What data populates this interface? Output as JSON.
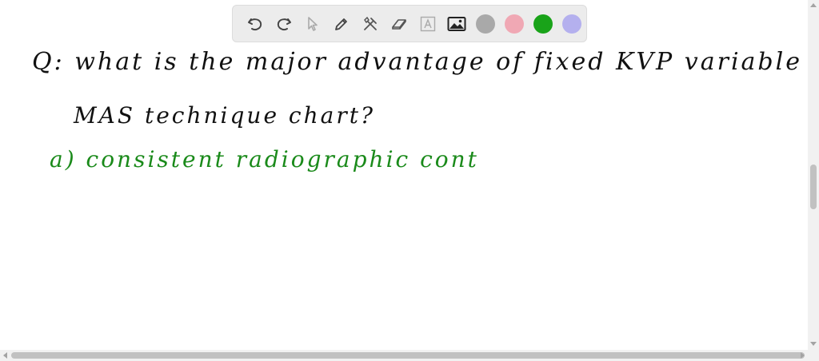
{
  "toolbar": {
    "tools": [
      {
        "icon": "undo-icon"
      },
      {
        "icon": "redo-icon"
      },
      {
        "icon": "select-pointer-icon"
      },
      {
        "icon": "pen-icon"
      },
      {
        "icon": "tools-icon"
      },
      {
        "icon": "eraser-icon"
      },
      {
        "icon": "text-icon"
      },
      {
        "icon": "image-icon"
      }
    ],
    "colors": [
      "#a9a9a9",
      "#f0a8b4",
      "#19a319",
      "#b4b0ee"
    ]
  },
  "notes": {
    "line1": "Q: what is the major advantage of fixed KVP variable",
    "line2": "MAS technique chart?",
    "line3": "a) consistent radiographic cont"
  },
  "ink_colors": {
    "question": "#111111",
    "answer": "#1a8a1a"
  }
}
